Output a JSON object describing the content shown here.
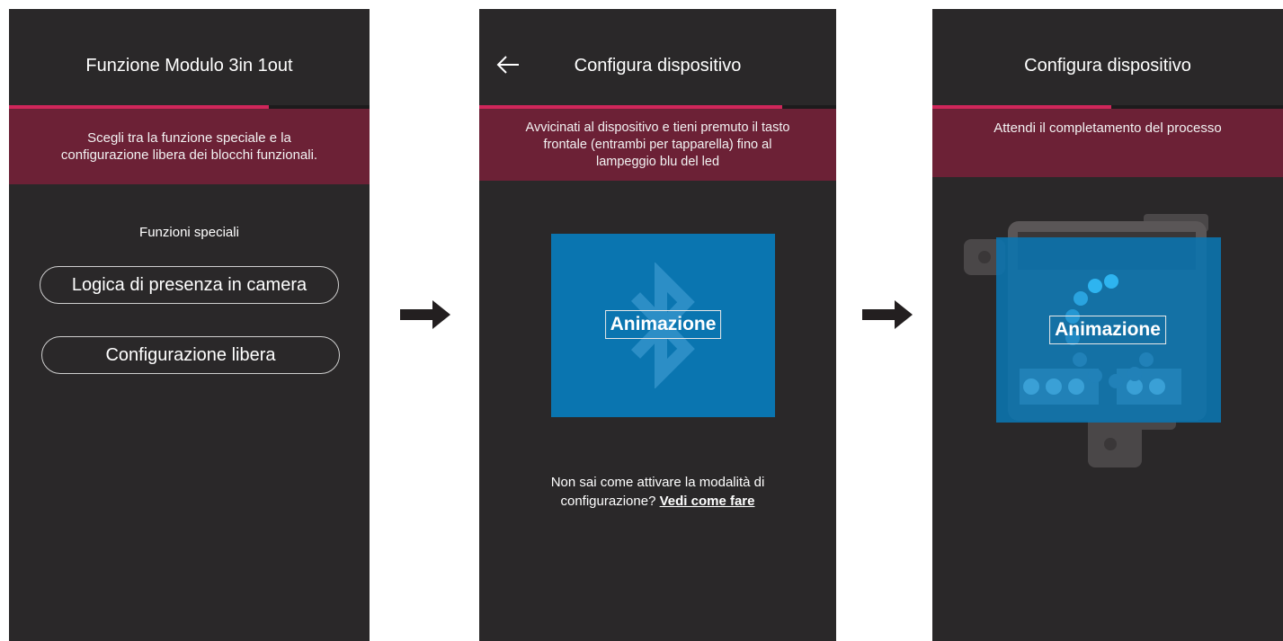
{
  "screens": [
    {
      "title": "Funzione Modulo 3in 1out",
      "progress": 0.72,
      "banner_lines": [
        "Scegli tra la funzione speciale e la",
        "configurazione libera dei blocchi funzionali."
      ],
      "section_label": "Funzioni speciali",
      "options": [
        "Logica di presenza in camera",
        "Configurazione libera"
      ]
    },
    {
      "title": "Configura dispositivo",
      "progress": 0.85,
      "banner_lines": [
        "Avvicinati al dispositivo e tieni premuto il tasto",
        "frontale (entrambi per tapparella) fino al",
        "lampeggio blu del led"
      ],
      "animation_label": "Animazione",
      "help_text_line1": "Non sai come attivare la modalità di",
      "help_text_line2": "configurazione?",
      "help_link": "Vedi come fare",
      "icon": "bluetooth-icon"
    },
    {
      "title": "Configura dispositivo",
      "progress": 0.51,
      "banner_lines": [
        "Attendi il completamento del processo"
      ],
      "animation_label": "Animazione",
      "icon": "loading-spinner-icon"
    }
  ],
  "colors": {
    "screen_bg": "#2a2829",
    "banner_bg": "#6c2136",
    "progress": "#d0265a",
    "animation_blue": "#0a75b0"
  }
}
